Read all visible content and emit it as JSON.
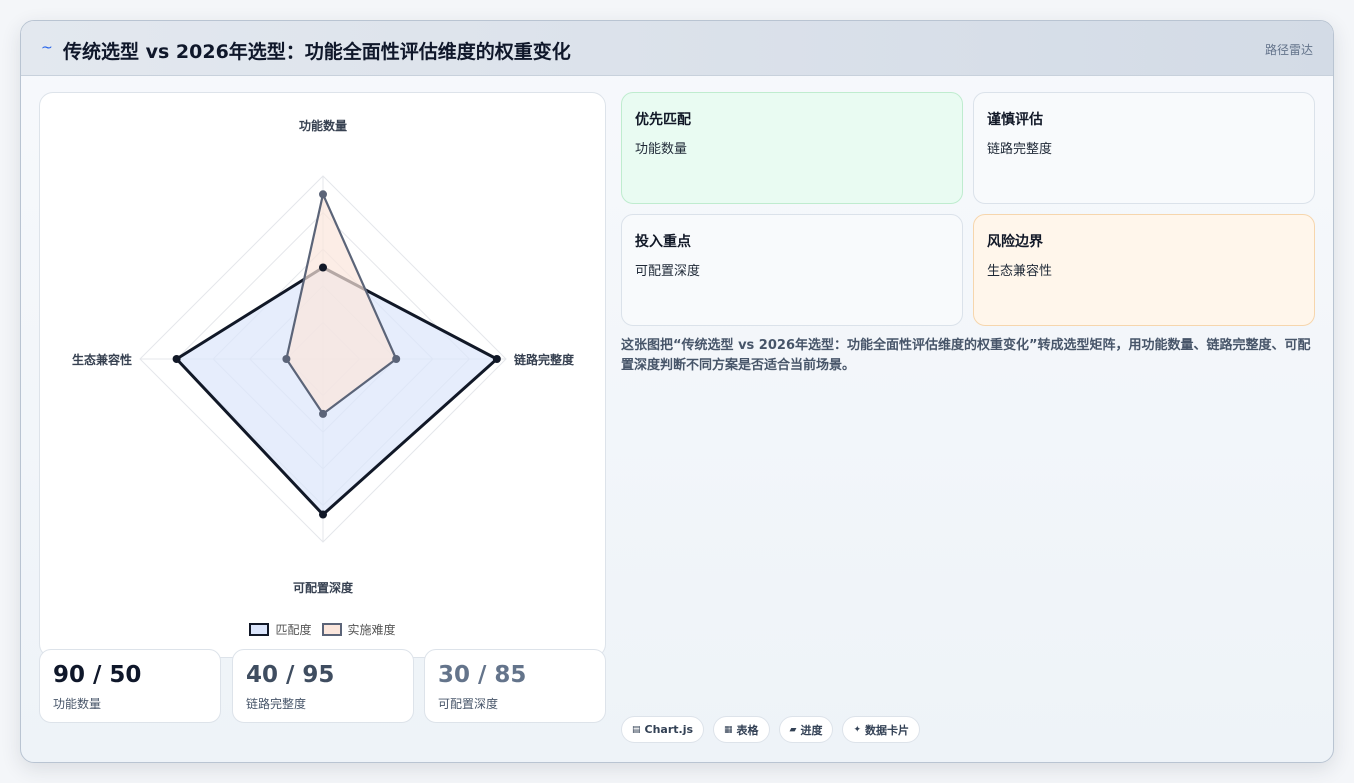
{
  "header": {
    "logo_icon": "~",
    "title": "传统选型 vs 2026年选型：功能全面性评估维度的权重变化",
    "tag": "路径雷达"
  },
  "chart_data": {
    "type": "radar",
    "title": "",
    "axes": [
      "功能数量",
      "链路完整度",
      "可配置深度",
      "生态兼容性"
    ],
    "rmax": 100,
    "ticks": [
      20,
      40,
      60,
      80,
      100
    ],
    "legend_position": "bottom",
    "series": [
      {
        "name": "匹配度",
        "values": [
          50,
          95,
          85,
          80
        ],
        "stroke": "#111827",
        "fill": "#dbe5fb"
      },
      {
        "name": "实施难度",
        "values": [
          90,
          40,
          30,
          20
        ],
        "stroke": "#5b6478",
        "fill": "#fbe6dc"
      }
    ]
  },
  "stats": [
    {
      "value": "90 / 50",
      "label": "功能数量",
      "color": "#0f172a"
    },
    {
      "value": "40 / 95",
      "label": "链路完整度",
      "color": "#3f4d60"
    },
    {
      "value": "30 / 85",
      "label": "可配置深度",
      "color": "#64748b"
    }
  ],
  "cards": [
    {
      "title": "优先匹配",
      "value": "功能数量"
    },
    {
      "title": "谨慎评估",
      "value": "链路完整度"
    },
    {
      "title": "投入重点",
      "value": "可配置深度"
    },
    {
      "title": "风险边界",
      "value": "生态兼容性"
    }
  ],
  "description": "这张图把“传统选型 vs 2026年选型：功能全面性评估维度的权重变化”转成选型矩阵，用功能数量、链路完整度、可配置深度判断不同方案是否适合当前场景。",
  "pills": [
    {
      "icon": "chart-icon",
      "glyph": "▤",
      "label": "Chart.js"
    },
    {
      "icon": "table-icon",
      "glyph": "▦",
      "label": "表格"
    },
    {
      "icon": "progress-icon",
      "glyph": "▰",
      "label": "进度"
    },
    {
      "icon": "sparkle-icon",
      "glyph": "✦",
      "label": "数据卡片"
    }
  ]
}
